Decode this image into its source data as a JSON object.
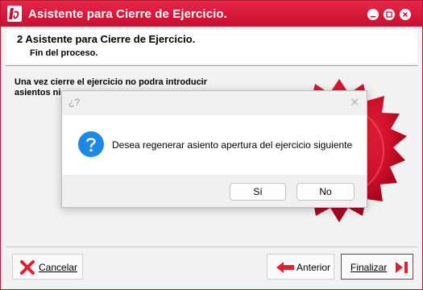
{
  "window": {
    "title": "Asistente para Cierre de Ejercicio."
  },
  "header": {
    "title": "2 Asistente para Cierre de Ejercicio.",
    "subtitle": "Fin del proceso."
  },
  "body": {
    "line1": "Una vez cierre el ejercicio no podra introducir",
    "line2": "asientos ni"
  },
  "footer": {
    "cancel_label": "Cancelar",
    "back_label": "Anterior",
    "finish_label": "Finalizar"
  },
  "dialog": {
    "title": "¿?",
    "message": "Desea regenerar asiento apertura del ejercicio siguiente",
    "yes_label": "Sí",
    "no_label": "No"
  },
  "colors": {
    "accent": "#c8102e",
    "dialog_icon": "#1e88e5"
  },
  "icons": [
    "app-logo-icon",
    "minimize-icon",
    "maximize-icon",
    "close-icon",
    "seal-icon",
    "cancel-x-icon",
    "back-arrow-icon",
    "finish-icon",
    "question-icon"
  ]
}
